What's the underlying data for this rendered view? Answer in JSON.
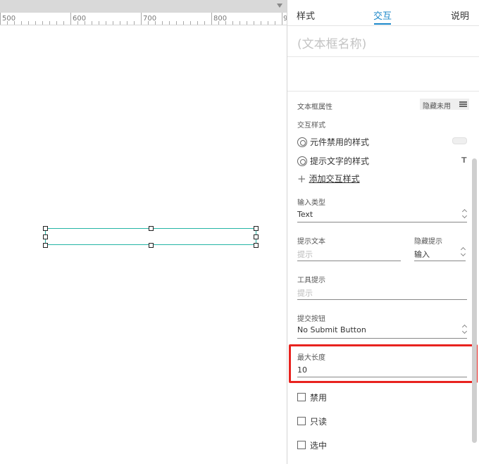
{
  "ruler": {
    "labels": [
      "500",
      "600",
      "700",
      "800",
      "9"
    ]
  },
  "tabs": [
    {
      "label": "样式",
      "active": false
    },
    {
      "label": "交互",
      "active": true
    },
    {
      "label": "说明",
      "active": false
    }
  ],
  "panel": {
    "name_placeholder": "(文本框名称)",
    "props_label": "文本框属性",
    "hide_unused_label": "隐藏未用",
    "interaction_styles_label": "交互样式",
    "styles": [
      {
        "label": "元件禁用的样式"
      },
      {
        "label": "提示文字的样式"
      }
    ],
    "add_style_label": "添加交互样式",
    "t_icon": "T",
    "input_type": {
      "label": "输入类型",
      "value": "Text"
    },
    "hint_text": {
      "label": "提示文本",
      "placeholder": "提示"
    },
    "hide_hint": {
      "label": "隐藏提示",
      "value": "输入"
    },
    "tooltip": {
      "label": "工具提示",
      "placeholder": "提示"
    },
    "submit_button": {
      "label": "提交按钮",
      "value": "No Submit Button"
    },
    "max_length": {
      "label": "最大长度",
      "value": "10"
    },
    "checkboxes": [
      {
        "label": "禁用",
        "checked": false
      },
      {
        "label": "只读",
        "checked": false
      },
      {
        "label": "选中",
        "checked": false
      }
    ]
  },
  "colors": {
    "accent": "#1b87c9",
    "selection": "#24b5a5",
    "highlight": "#e8231f"
  }
}
